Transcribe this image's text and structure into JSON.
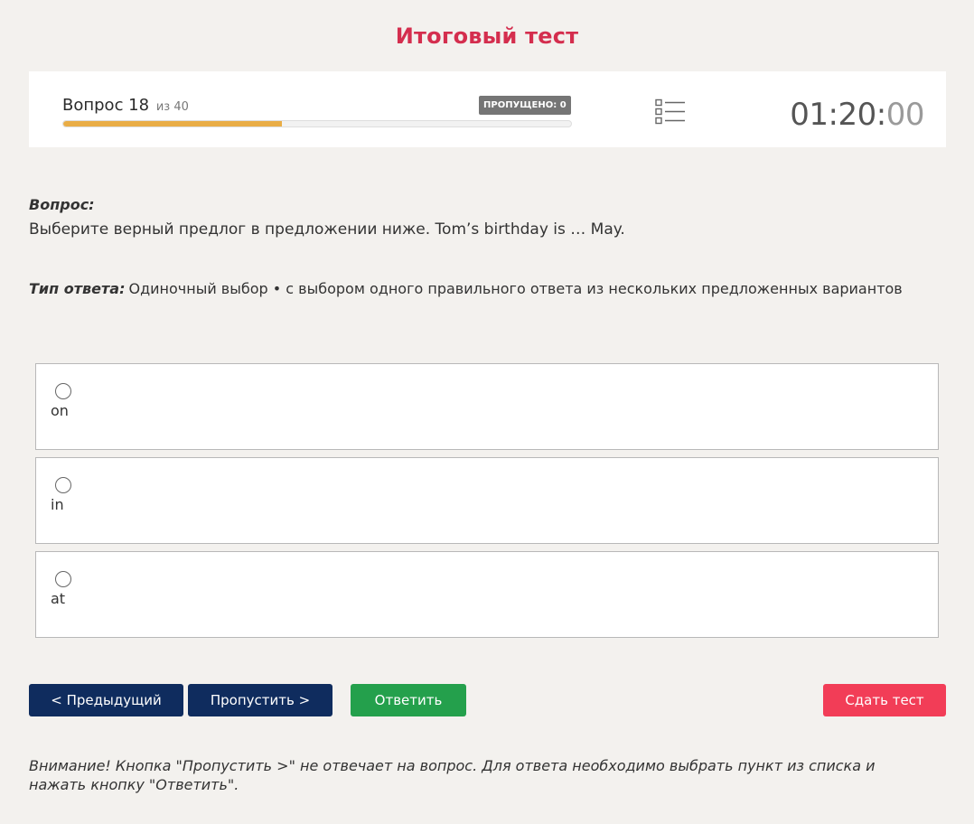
{
  "page": {
    "title": "Итоговый тест"
  },
  "status": {
    "question_label": "Вопрос 18",
    "question_of": "из 40",
    "current_question": 18,
    "total_questions": 40,
    "progress_fraction": 0.43,
    "skipped_badge": "ПРОПУЩЕНО: 0",
    "timer_main": "01:20:",
    "timer_seconds": "00",
    "list_icon": "list-icon"
  },
  "question": {
    "label": "Вопрос:",
    "text": "Выберите верный предлог в предложении ниже. Tom’s birthday is … May.",
    "answer_type_label": "Тип ответа:",
    "answer_type": "Одиночный выбор • с выбором одного правильного ответа из нескольких предложенных вариантов"
  },
  "options": [
    {
      "label": "on",
      "selected": false
    },
    {
      "label": "in",
      "selected": false
    },
    {
      "label": "at",
      "selected": false
    }
  ],
  "buttons": {
    "prev": "< Предыдущий",
    "skip": "Пропустить >",
    "answer": "Ответить",
    "submit": "Сдать тест"
  },
  "notice": "Внимание! Кнопка \"Пропустить >\" не отвечает на вопрос. Для ответа необходимо выбрать пункт из списка и нажать кнопку \"Ответить\".",
  "colors": {
    "title": "#d42e4e",
    "progress": "#e9ad46",
    "nav_buttons": "#0f2c5e",
    "answer_button": "#24a04c",
    "submit_button": "#f23d57"
  }
}
